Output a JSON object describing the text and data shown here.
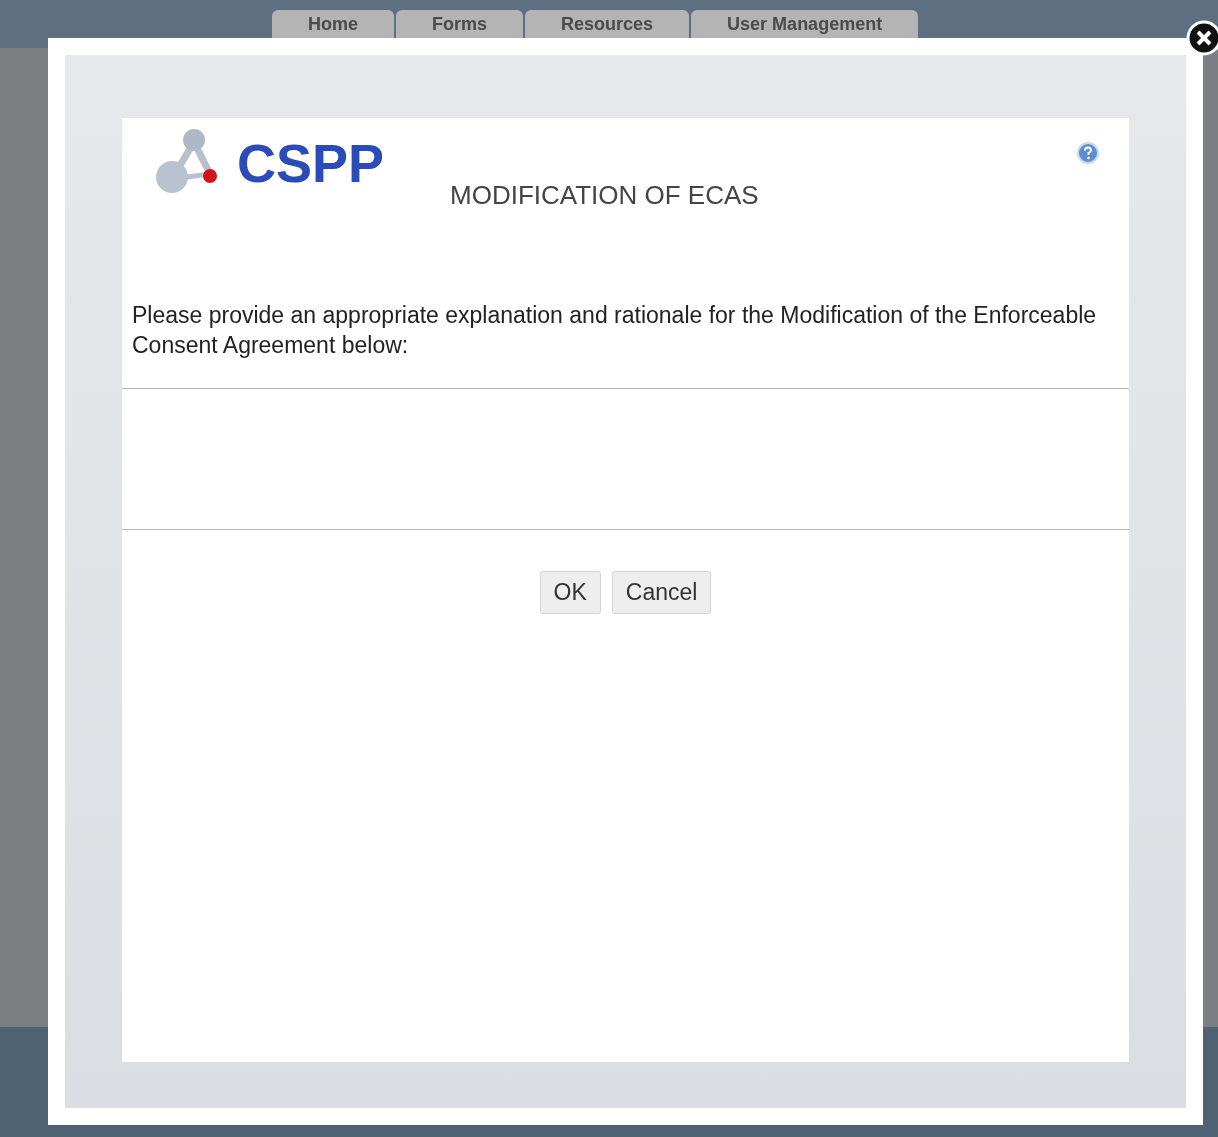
{
  "nav_tabs": [
    {
      "label": "Home",
      "selected": false
    },
    {
      "label": "Forms",
      "selected": false
    },
    {
      "label": "Resources",
      "selected": false
    },
    {
      "label": "User Management",
      "selected": false
    }
  ],
  "dialog": {
    "logo_text": "CSPP",
    "title": "MODIFICATION OF ECAS",
    "instructions": "Please provide an appropriate explanation and rationale for the Modification of the Enforceable Consent Agreement below:",
    "buttons": [
      "OK",
      "Cancel"
    ]
  }
}
